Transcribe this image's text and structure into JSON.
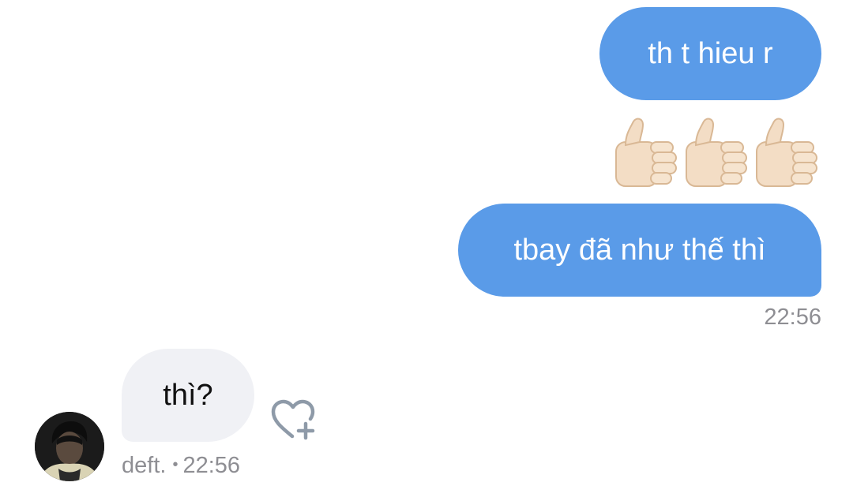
{
  "messages": {
    "out_1": {
      "text": "th t hieu r"
    },
    "out_reaction": {
      "emoji": "thumbs-up-icon",
      "count": 3
    },
    "out_2": {
      "text": "tbay đã như thế thì"
    },
    "out_time": "22:56",
    "in_1": {
      "text": "thì?"
    },
    "in_sender": "deft.",
    "in_separator": "•",
    "in_time": "22:56"
  },
  "colors": {
    "outgoing_bubble": "#5a9be8",
    "incoming_bubble": "#f0f1f5",
    "timestamp": "#8e8e93"
  }
}
